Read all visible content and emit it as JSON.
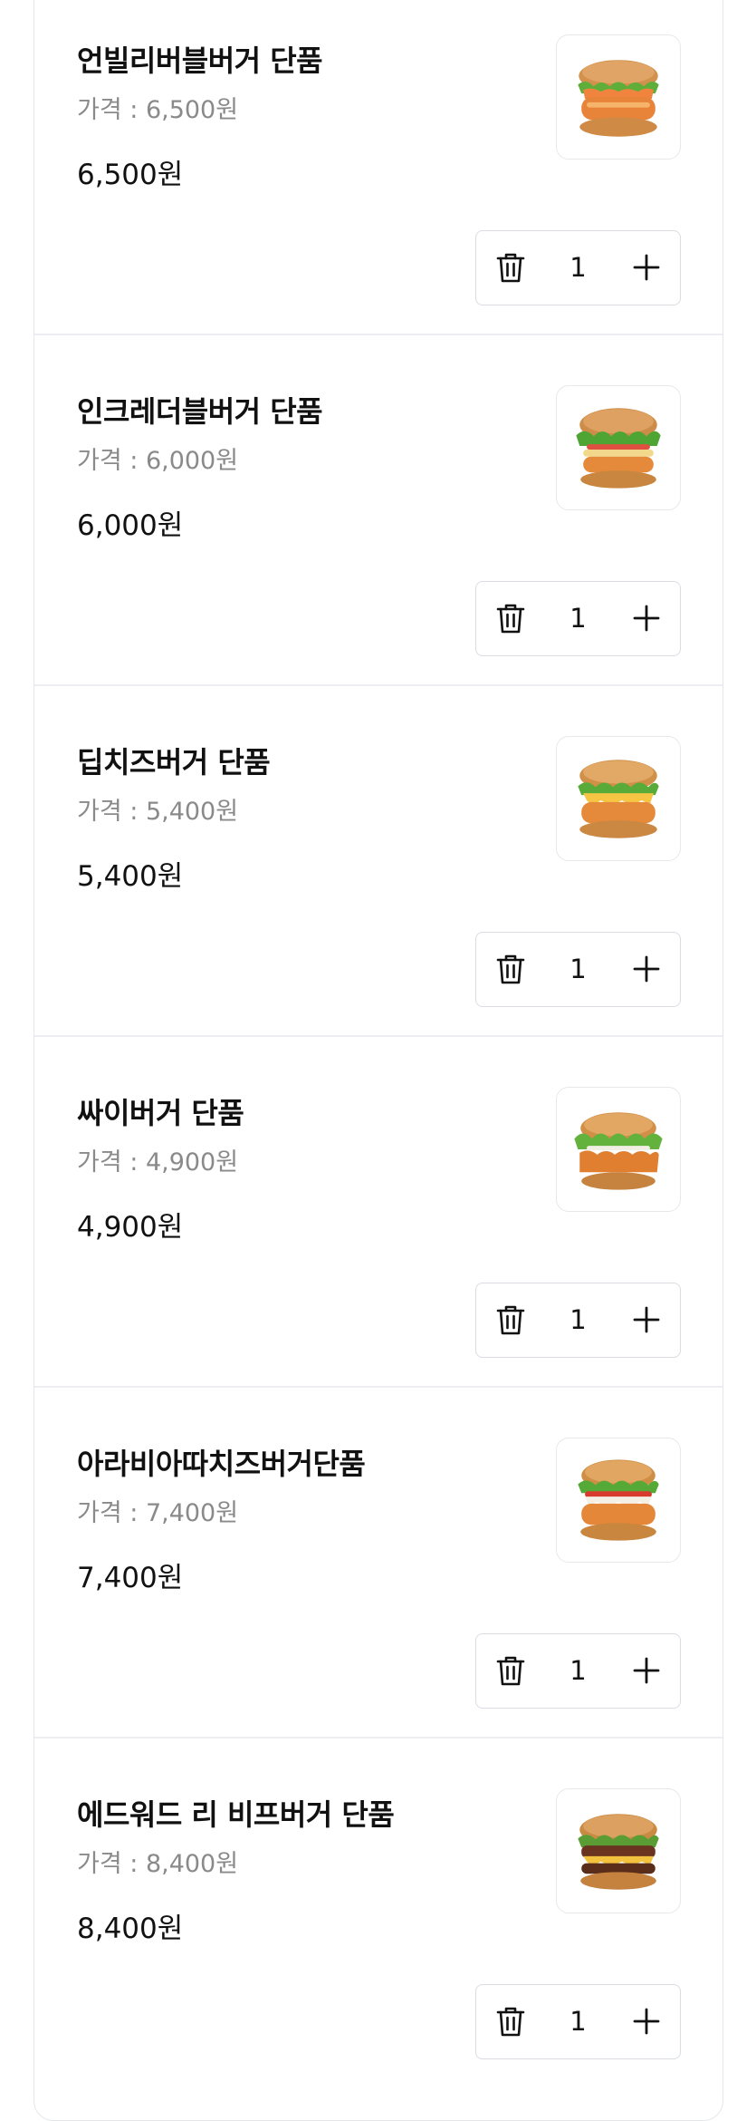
{
  "cart": {
    "items": [
      {
        "name": "언빌리버블버거 단품",
        "unit_price": "가격 : 6,500원",
        "total": "6,500원",
        "quantity": "1",
        "image": "chicken-shrimp-burger"
      },
      {
        "name": "인크레더블버거 단품",
        "unit_price": "가격 : 6,000원",
        "total": "6,000원",
        "quantity": "1",
        "image": "chicken-lettuce-burger"
      },
      {
        "name": "딥치즈버거 단품",
        "unit_price": "가격 : 5,400원",
        "total": "5,400원",
        "quantity": "1",
        "image": "cheese-chicken-burger"
      },
      {
        "name": "싸이버거 단품",
        "unit_price": "가격 : 4,900원",
        "total": "4,900원",
        "quantity": "1",
        "image": "chicken-thigh-burger"
      },
      {
        "name": "아라비아따치즈버거단품",
        "unit_price": "가격 : 7,400원",
        "total": "7,400원",
        "quantity": "1",
        "image": "arrabbiata-cheese-burger"
      },
      {
        "name": "에드워드 리 비프버거 단품",
        "unit_price": "가격 : 8,400원",
        "total": "8,400원",
        "quantity": "1",
        "image": "beef-burger"
      }
    ]
  },
  "icons": {
    "delete": "trash-icon",
    "increase": "plus-icon"
  },
  "colors": {
    "text": "#111111",
    "secondary_text": "#8a8a8a",
    "border": "#d9dce1",
    "background": "#ffffff"
  }
}
